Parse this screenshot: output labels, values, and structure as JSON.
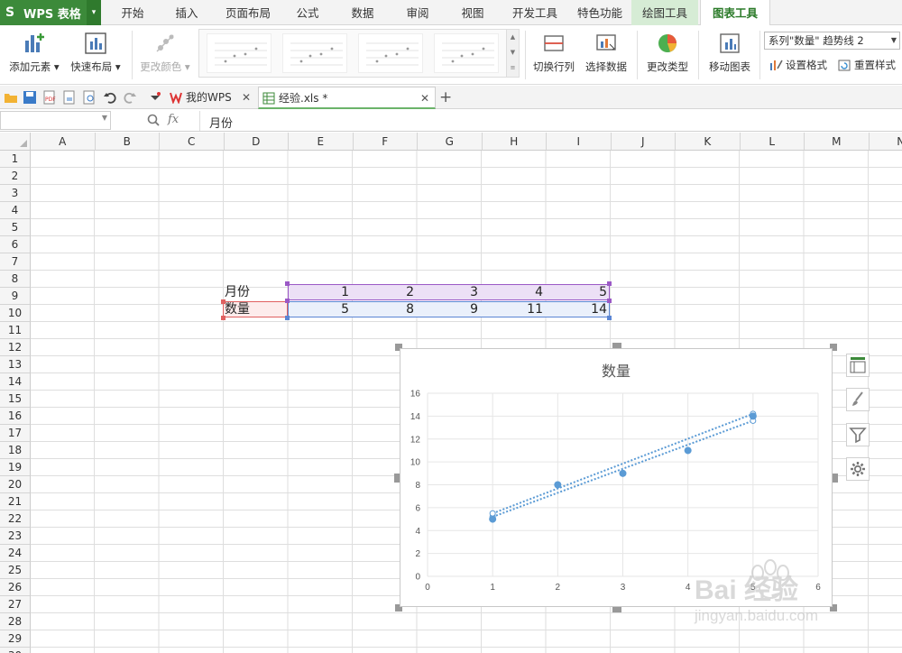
{
  "app": {
    "name": "WPS 表格",
    "logo": "S"
  },
  "menu": {
    "tabs": [
      {
        "label": "开始"
      },
      {
        "label": "插入"
      },
      {
        "label": "页面布局"
      },
      {
        "label": "公式"
      },
      {
        "label": "数据"
      },
      {
        "label": "审阅"
      },
      {
        "label": "视图"
      },
      {
        "label": "开发工具"
      },
      {
        "label": "特色功能"
      },
      {
        "label": "绘图工具"
      },
      {
        "label": "图表工具"
      }
    ]
  },
  "ribbon": {
    "add_element": "添加元素 ▾",
    "quick_layout": "快速布局 ▾",
    "change_color": "更改颜色 ▾",
    "switch_row_col": "切换行列",
    "select_data": "选择数据",
    "change_type": "更改类型",
    "move_chart": "移动图表",
    "series_select": "系列\"数量\" 趋势线 2",
    "set_format": "设置格式",
    "reset_style": "重置样式"
  },
  "tabs": {
    "home": "我的WPS",
    "file": "经验.xls *"
  },
  "formula": {
    "fx": "fx",
    "content": "月份"
  },
  "columns": [
    "A",
    "B",
    "C",
    "D",
    "E",
    "F",
    "G",
    "H",
    "I",
    "J",
    "K",
    "L",
    "M",
    "N"
  ],
  "rows": [
    "1",
    "2",
    "3",
    "4",
    "5",
    "6",
    "7",
    "8",
    "9",
    "10",
    "11",
    "12",
    "13",
    "14",
    "15",
    "16",
    "17",
    "18",
    "19",
    "20",
    "21",
    "22",
    "23",
    "24",
    "25",
    "26",
    "27",
    "28",
    "29",
    "30"
  ],
  "cells": {
    "d9": "月份",
    "e9": "1",
    "f9": "2",
    "g9": "3",
    "h9": "4",
    "i9": "5",
    "d10": "数量",
    "e10": "5",
    "f10": "8",
    "g10": "9",
    "h10": "11",
    "i10": "14"
  },
  "chart_data": {
    "type": "scatter",
    "title": "数量",
    "xlabel": "",
    "ylabel": "",
    "xlim": [
      0,
      6
    ],
    "ylim": [
      0,
      16
    ],
    "x_ticks": [
      0,
      1,
      2,
      3,
      4,
      5,
      6
    ],
    "y_ticks": [
      0,
      2,
      4,
      6,
      8,
      10,
      12,
      14,
      16
    ],
    "grid": true,
    "series": [
      {
        "x": [
          1,
          2,
          3,
          4,
          5
        ],
        "values": [
          5,
          8,
          9,
          11,
          14
        ]
      }
    ],
    "trendlines": [
      {
        "kind": "linear",
        "x": [
          1,
          5
        ],
        "values": [
          5.2,
          13.6
        ]
      },
      {
        "kind": "polynomial",
        "x": [
          1,
          5
        ],
        "values": [
          5.5,
          14.2
        ]
      }
    ],
    "colors": {
      "marker": "#5b9bd5",
      "trend": "#5b9bd5",
      "grid": "#e6e6e6"
    }
  },
  "watermark": {
    "brand": "Bai 经验",
    "url": "jingyan.baidu.com"
  }
}
